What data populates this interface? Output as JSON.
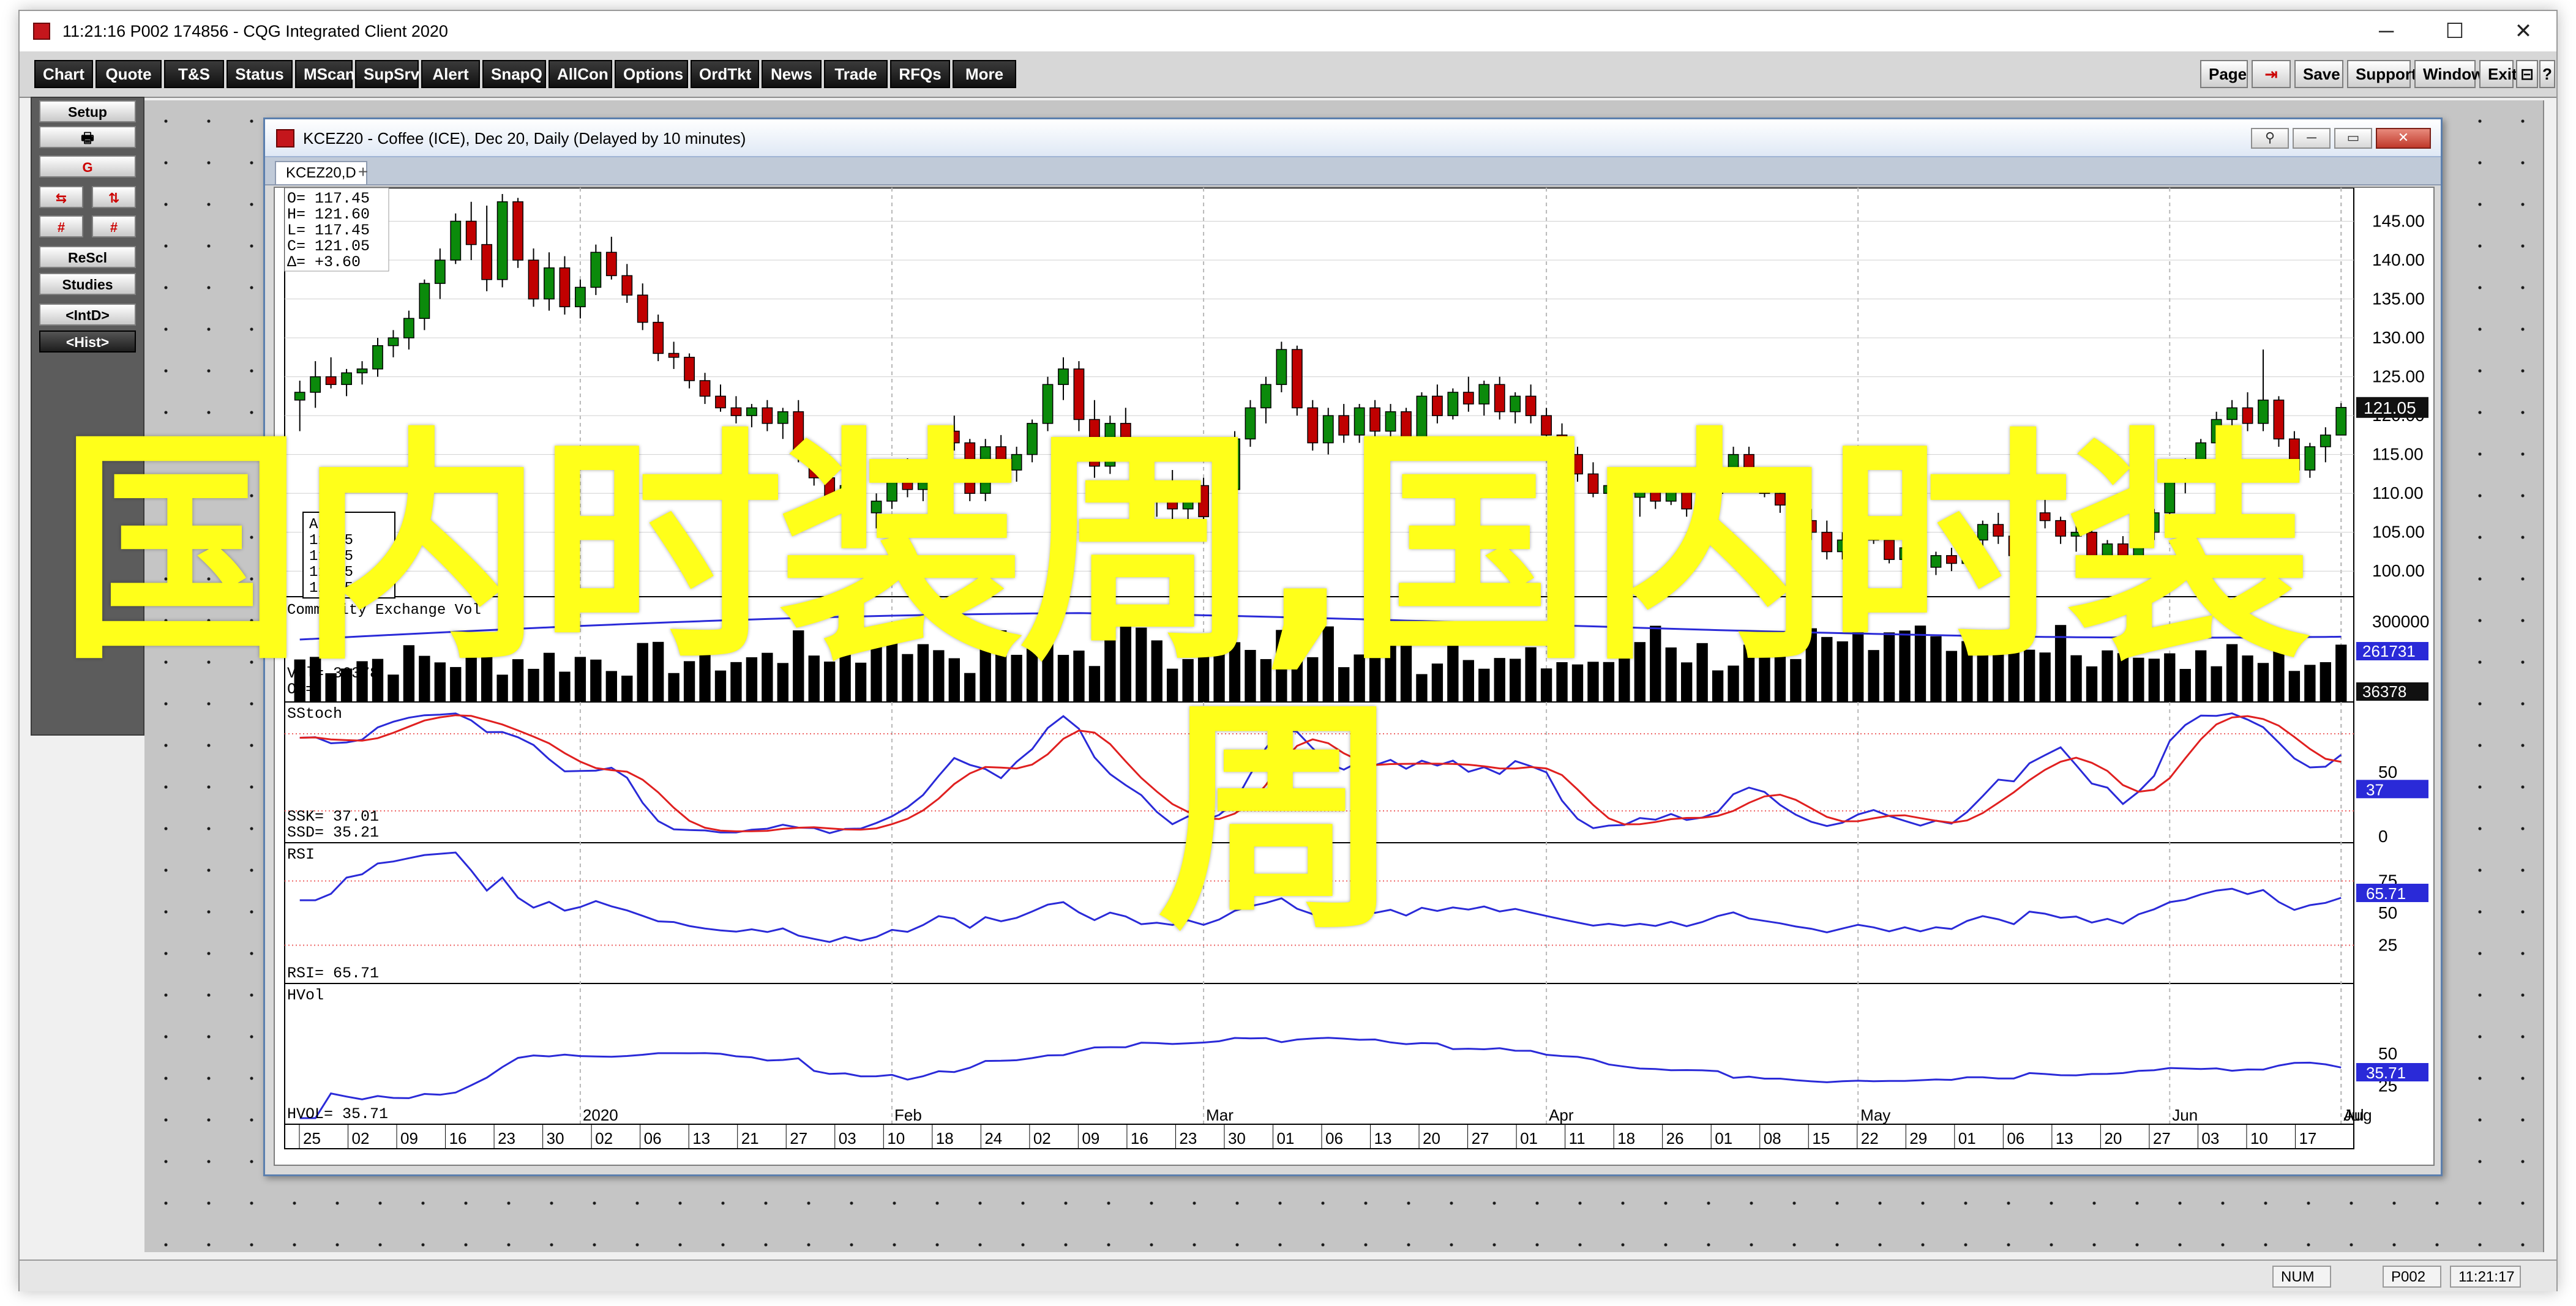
{
  "app": {
    "title": "11:21:16   P002   174856 - CQG Integrated Client 2020",
    "controls": [
      "─",
      "☐",
      "✕"
    ]
  },
  "toolbar": {
    "left": [
      "Chart",
      "Quote",
      "T&S",
      "Status",
      "MScan",
      "SupSrv",
      "Alert",
      "SnapQ",
      "AllCon",
      "Options",
      "OrdTkt",
      "News",
      "Trade",
      "RFQs",
      "More"
    ],
    "right": [
      "Page",
      "⇥",
      "Save",
      "Support",
      "Window",
      "Exit",
      "⊟",
      "?"
    ]
  },
  "sidebar": {
    "setup": "Setup",
    "print_icon": "🖶",
    "g_button": "G",
    "swap1": "⇆",
    "swap2": "⇅",
    "hash1": "#",
    "hash2": "#",
    "rescl": "ReScl",
    "studies": "Studies",
    "intd": "<IntD>",
    "hist": "<Hist>"
  },
  "chart_window": {
    "title": "KCEZ20 - Coffee (ICE), Dec 20, Daily (Delayed by 10 minutes)",
    "tab": "KCEZ20,D",
    "tab_add": "+",
    "controls": [
      "⚲",
      "─",
      "▭",
      "✕"
    ]
  },
  "chart_data": {
    "type": "candlestick",
    "instrument": "KCEZ20",
    "ohlc_box": {
      "O": "117.45",
      "H": "121.60",
      "L": "117.45",
      "C": "121.05",
      "delta": "+3.60"
    },
    "price_axis": {
      "ticks": [
        "145.00",
        "140.00",
        "135.00",
        "130.00",
        "125.00",
        "120.00",
        "115.00",
        "110.00",
        "105.00",
        "100.00"
      ],
      "min": 97.5,
      "max": 148.5,
      "last_label": "121.05",
      "last_value": 121.05
    },
    "candles": [
      [
        122.0,
        124.5,
        118.0,
        123.0
      ],
      [
        123.0,
        127.0,
        121.0,
        125.0
      ],
      [
        125.0,
        127.5,
        123.5,
        124.0
      ],
      [
        124.0,
        126.0,
        122.5,
        125.5
      ],
      [
        125.5,
        127.0,
        124.0,
        126.0
      ],
      [
        126.0,
        130.0,
        125.0,
        129.0
      ],
      [
        129.0,
        131.0,
        127.5,
        130.0
      ],
      [
        130.0,
        133.5,
        128.5,
        132.5
      ],
      [
        132.5,
        137.5,
        131.0,
        137.0
      ],
      [
        137.0,
        141.5,
        135.0,
        140.0
      ],
      [
        140.0,
        146.0,
        139.5,
        145.0
      ],
      [
        145.0,
        147.5,
        140.0,
        142.0
      ],
      [
        142.0,
        147.0,
        136.0,
        137.5
      ],
      [
        137.5,
        148.5,
        136.5,
        147.5
      ],
      [
        147.5,
        148.0,
        139.0,
        140.0
      ],
      [
        140.0,
        141.5,
        134.0,
        135.0
      ],
      [
        135.0,
        141.0,
        133.5,
        139.0
      ],
      [
        139.0,
        140.5,
        133.0,
        134.0
      ],
      [
        134.0,
        137.5,
        132.5,
        136.5
      ],
      [
        136.5,
        142.0,
        135.5,
        141.0
      ],
      [
        141.0,
        143.0,
        137.5,
        138.0
      ],
      [
        138.0,
        139.5,
        134.5,
        135.5
      ],
      [
        135.5,
        137.0,
        131.0,
        132.0
      ],
      [
        132.0,
        133.0,
        127.0,
        128.0
      ],
      [
        128.0,
        129.5,
        126.0,
        127.5
      ],
      [
        127.5,
        128.0,
        123.5,
        124.5
      ],
      [
        124.5,
        125.5,
        121.5,
        122.5
      ],
      [
        122.5,
        124.0,
        120.5,
        121.0
      ],
      [
        121.0,
        122.5,
        119.0,
        120.0
      ],
      [
        120.0,
        121.5,
        118.5,
        121.0
      ],
      [
        121.0,
        122.0,
        118.0,
        119.0
      ],
      [
        119.0,
        121.0,
        117.0,
        120.5
      ],
      [
        120.5,
        122.0,
        114.0,
        115.0
      ],
      [
        115.0,
        116.0,
        111.0,
        112.0
      ],
      [
        112.0,
        113.5,
        108.5,
        109.0
      ],
      [
        109.0,
        112.0,
        107.0,
        111.0
      ],
      [
        111.0,
        112.0,
        106.5,
        107.5
      ],
      [
        107.5,
        110.0,
        105.5,
        109.0
      ],
      [
        109.0,
        112.5,
        108.0,
        112.0
      ],
      [
        112.0,
        114.5,
        109.5,
        110.5
      ],
      [
        110.5,
        114.0,
        109.0,
        113.5
      ],
      [
        113.5,
        118.5,
        112.5,
        118.0
      ],
      [
        118.0,
        120.0,
        115.5,
        116.5
      ],
      [
        116.5,
        117.0,
        109.0,
        110.0
      ],
      [
        110.0,
        117.0,
        109.0,
        116.0
      ],
      [
        116.0,
        117.5,
        112.0,
        113.0
      ],
      [
        113.0,
        116.0,
        111.5,
        115.0
      ],
      [
        115.0,
        119.5,
        114.0,
        119.0
      ],
      [
        119.0,
        125.0,
        118.0,
        124.0
      ],
      [
        124.0,
        127.5,
        122.0,
        126.0
      ],
      [
        126.0,
        127.0,
        118.0,
        119.5
      ],
      [
        119.5,
        122.0,
        112.0,
        113.5
      ],
      [
        113.5,
        120.0,
        112.5,
        119.0
      ],
      [
        119.0,
        121.0,
        115.0,
        116.0
      ],
      [
        116.0,
        117.0,
        108.0,
        109.0
      ],
      [
        109.0,
        111.0,
        107.0,
        110.0
      ],
      [
        110.0,
        113.0,
        106.0,
        108.0
      ],
      [
        108.0,
        111.5,
        106.5,
        111.0
      ],
      [
        111.0,
        112.0,
        106.0,
        107.0
      ],
      [
        107.0,
        111.0,
        105.5,
        110.5
      ],
      [
        110.5,
        118.0,
        110.0,
        117.0
      ],
      [
        117.0,
        122.0,
        116.0,
        121.0
      ],
      [
        121.0,
        125.0,
        119.0,
        124.0
      ],
      [
        124.0,
        129.5,
        123.0,
        128.5
      ],
      [
        128.5,
        129.0,
        120.0,
        121.0
      ],
      [
        121.0,
        122.0,
        115.5,
        116.5
      ],
      [
        116.5,
        121.0,
        115.0,
        120.0
      ],
      [
        120.0,
        121.5,
        116.5,
        117.5
      ],
      [
        117.5,
        121.5,
        116.5,
        121.0
      ],
      [
        121.0,
        122.0,
        117.0,
        118.0
      ],
      [
        118.0,
        121.5,
        117.0,
        120.5
      ],
      [
        120.5,
        121.0,
        115.0,
        116.0
      ],
      [
        116.0,
        123.0,
        115.5,
        122.5
      ],
      [
        122.5,
        124.0,
        119.0,
        120.0
      ],
      [
        120.0,
        123.5,
        119.5,
        123.0
      ],
      [
        123.0,
        125.0,
        120.5,
        121.5
      ],
      [
        121.5,
        124.5,
        120.0,
        124.0
      ],
      [
        124.0,
        125.0,
        119.5,
        120.5
      ],
      [
        120.5,
        123.0,
        119.0,
        122.5
      ],
      [
        122.5,
        124.0,
        119.0,
        120.0
      ],
      [
        120.0,
        121.0,
        116.5,
        117.5
      ],
      [
        117.5,
        119.0,
        114.0,
        115.0
      ],
      [
        115.0,
        116.0,
        111.5,
        112.5
      ],
      [
        112.5,
        114.0,
        109.5,
        110.0
      ],
      [
        110.0,
        112.0,
        108.5,
        111.0
      ],
      [
        111.0,
        112.5,
        108.0,
        109.5
      ],
      [
        109.5,
        111.0,
        107.0,
        110.5
      ],
      [
        110.5,
        112.0,
        108.0,
        109.0
      ],
      [
        109.0,
        111.5,
        108.5,
        111.0
      ],
      [
        111.0,
        112.0,
        107.0,
        108.0
      ],
      [
        108.0,
        110.5,
        107.5,
        110.0
      ],
      [
        110.0,
        113.5,
        109.5,
        113.0
      ],
      [
        113.0,
        116.0,
        112.0,
        115.0
      ],
      [
        115.0,
        116.0,
        110.5,
        111.5
      ],
      [
        111.5,
        113.0,
        109.5,
        110.0
      ],
      [
        110.0,
        112.0,
        107.5,
        108.5
      ],
      [
        108.5,
        110.0,
        105.5,
        106.5
      ],
      [
        106.5,
        108.0,
        104.0,
        105.0
      ],
      [
        105.0,
        106.5,
        101.5,
        102.5
      ],
      [
        102.5,
        105.0,
        101.5,
        104.0
      ],
      [
        104.0,
        106.5,
        103.0,
        105.5
      ],
      [
        105.5,
        107.0,
        103.5,
        104.0
      ],
      [
        104.0,
        105.0,
        101.0,
        101.5
      ],
      [
        101.5,
        103.5,
        100.5,
        103.0
      ],
      [
        103.0,
        104.0,
        99.5,
        100.5
      ],
      [
        100.5,
        102.5,
        99.5,
        102.0
      ],
      [
        102.0,
        103.0,
        100.0,
        101.0
      ],
      [
        101.0,
        104.5,
        100.5,
        104.0
      ],
      [
        104.0,
        106.5,
        103.0,
        106.0
      ],
      [
        106.0,
        107.5,
        103.5,
        104.5
      ],
      [
        104.5,
        105.0,
        101.0,
        102.0
      ],
      [
        102.0,
        108.0,
        101.5,
        107.5
      ],
      [
        107.5,
        110.0,
        105.5,
        106.5
      ],
      [
        106.5,
        107.0,
        103.5,
        104.5
      ],
      [
        104.5,
        106.0,
        102.5,
        105.0
      ],
      [
        105.0,
        105.5,
        101.5,
        102.0
      ],
      [
        102.0,
        104.0,
        101.0,
        103.5
      ],
      [
        103.5,
        104.5,
        100.0,
        101.0
      ],
      [
        101.0,
        105.5,
        100.5,
        105.0
      ],
      [
        105.0,
        108.0,
        104.0,
        107.5
      ],
      [
        107.5,
        112.0,
        107.0,
        111.5
      ],
      [
        111.5,
        114.5,
        110.0,
        113.0
      ],
      [
        113.0,
        117.0,
        112.0,
        116.5
      ],
      [
        116.5,
        120.5,
        115.5,
        119.5
      ],
      [
        119.5,
        122.0,
        117.0,
        121.0
      ],
      [
        121.0,
        123.0,
        118.0,
        119.0
      ],
      [
        119.0,
        128.5,
        118.0,
        122.0
      ],
      [
        122.0,
        122.5,
        116.0,
        117.0
      ],
      [
        117.0,
        118.0,
        112.0,
        113.0
      ],
      [
        113.0,
        116.5,
        112.0,
        116.0
      ],
      [
        116.0,
        118.5,
        114.0,
        117.5
      ],
      [
        117.5,
        121.6,
        117.45,
        121.05
      ]
    ],
    "volume_panel": {
      "label": "Vol= 36378",
      "oi_label": "OI=",
      "axis": [
        "300000"
      ],
      "oi_value": "261731",
      "vol_value": "36378",
      "legend": "Commodity Exchange Vol",
      "legend_b": "Commodity OI"
    },
    "sstoch_panel": {
      "label": "SStoch",
      "ssk": "SSK= 37.01",
      "ssd": "SSD= 35.21",
      "axis": [
        "50",
        "0"
      ],
      "value": "37",
      "lines": [
        80,
        20
      ]
    },
    "rsi_panel": {
      "label": "RSI",
      "value_label": "RSI= 65.71",
      "axis": [
        "75",
        "50",
        "25"
      ],
      "value": "65.71"
    },
    "hvol_panel": {
      "label": "HVol",
      "value_label": "HVOL= 35.71",
      "axis": [
        "50",
        "25"
      ],
      "value": "35.71"
    },
    "date_axis": {
      "days": [
        "25",
        "02",
        "09",
        "16",
        "23",
        "30",
        "02",
        "06",
        "13",
        "21",
        "27",
        "03",
        "10",
        "18",
        "24",
        "02",
        "09",
        "16",
        "23",
        "30",
        "01",
        "06",
        "13",
        "20",
        "27",
        "01",
        "11",
        "18",
        "26",
        "01",
        "08",
        "15",
        "22",
        "29",
        "01",
        "06",
        "13",
        "20",
        "27",
        "03",
        "10",
        "17"
      ],
      "months": [
        "2020",
        "Feb",
        "Mar",
        "Apr",
        "May",
        "Jun",
        "Jul",
        "Aug"
      ]
    },
    "legend_box": [
      "Aug",
      "117.5",
      "117.5",
      "117.5",
      "121.5"
    ]
  },
  "status": {
    "num": "NUM",
    "page": "P002",
    "time": "11:21:17"
  },
  "overlay": {
    "line1": "国内时装周,国内时装",
    "line2": "周"
  },
  "colors": {
    "up": "#0b8a0b",
    "down": "#c00000",
    "line_blue": "#2a2ad8",
    "line_red": "#e02020",
    "label_blue": "#2a2ad8",
    "overlay": "#ffff1a"
  }
}
